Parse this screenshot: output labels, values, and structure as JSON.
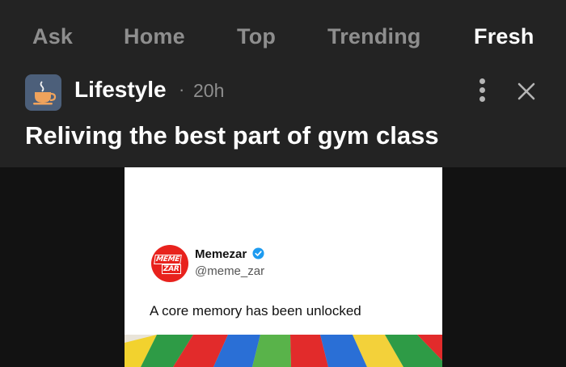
{
  "tabs": [
    {
      "label": "Ask",
      "active": false
    },
    {
      "label": "Home",
      "active": false
    },
    {
      "label": "Top",
      "active": false
    },
    {
      "label": "Trending",
      "active": false
    },
    {
      "label": "Fresh",
      "active": true
    }
  ],
  "post": {
    "category": "Lifestyle",
    "separator": "·",
    "time": "20h",
    "category_icon": "coffee-cup-icon",
    "title": "Reliving the best part of gym class"
  },
  "tweet": {
    "account_name": "Memezar",
    "handle": "@meme_zar",
    "avatar_line1": "MEME",
    "avatar_line2": "ZAR",
    "text": "A core memory has been unlocked"
  },
  "colors": {
    "header_bg": "#232323",
    "page_bg": "#121212",
    "tab_inactive": "#8e8e8e",
    "verified_blue": "#1d9bf0",
    "avatar_red": "#e8221d",
    "parachute": [
      "#f2d22e",
      "#2e9b46",
      "#e22b2b",
      "#2a6fd6",
      "#59b34a",
      "#f3d13a"
    ]
  }
}
